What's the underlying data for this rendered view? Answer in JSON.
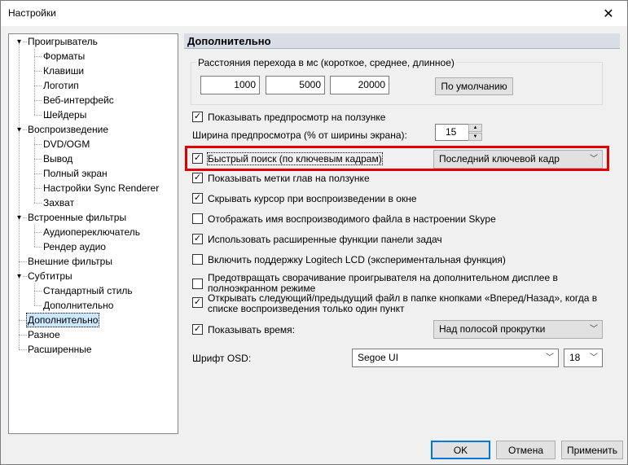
{
  "window": {
    "title": "Настройки",
    "close_glyph": "✕"
  },
  "tree": {
    "items": [
      {
        "label": "Проигрыватель",
        "level": 0,
        "expanded": true
      },
      {
        "label": "Форматы",
        "level": 1
      },
      {
        "label": "Клавиши",
        "level": 1
      },
      {
        "label": "Логотип",
        "level": 1
      },
      {
        "label": "Веб-интерфейс",
        "level": 1
      },
      {
        "label": "Шейдеры",
        "level": 1
      },
      {
        "label": "Воспроизведение",
        "level": 0,
        "expanded": true
      },
      {
        "label": "DVD/OGM",
        "level": 1
      },
      {
        "label": "Вывод",
        "level": 1
      },
      {
        "label": "Полный экран",
        "level": 1
      },
      {
        "label": "Настройки Sync Renderer",
        "level": 1
      },
      {
        "label": "Захват",
        "level": 1
      },
      {
        "label": "Встроенные фильтры",
        "level": 0,
        "expanded": true
      },
      {
        "label": "Аудиопереключатель",
        "level": 1
      },
      {
        "label": "Рендер аудио",
        "level": 1
      },
      {
        "label": "Внешние фильтры",
        "level": 0
      },
      {
        "label": "Субтитры",
        "level": 0,
        "expanded": true
      },
      {
        "label": "Стандартный стиль",
        "level": 1
      },
      {
        "label": "Дополнительно",
        "level": 1
      },
      {
        "label": "Дополнительно",
        "level": 0,
        "selected": true
      },
      {
        "label": "Разное",
        "level": 0
      },
      {
        "label": "Расширенные",
        "level": 0
      }
    ]
  },
  "page": {
    "header": "Дополнительно",
    "seek_group": {
      "legend": "Расстояния перехода в мс (короткое, среднее, длинное)",
      "short": "1000",
      "medium": "5000",
      "long": "20000",
      "default_button": "По умолчанию"
    },
    "preview_on_seekbar": {
      "label": "Показывать предпросмотр на ползунке",
      "checked": true
    },
    "preview_width": {
      "label": "Ширина предпросмотра (% от ширины экрана):",
      "value": "15"
    },
    "fast_seek": {
      "label": "Быстрый поиск (по ключевым кадрам)",
      "checked": true,
      "select_value": "Последний ключевой кадр"
    },
    "chapter_marks": {
      "label": "Показывать метки глав на ползунке",
      "checked": true
    },
    "hide_cursor": {
      "label": "Скрывать курсор при воспроизведении в окне",
      "checked": true
    },
    "skype_status": {
      "label": "Отображать имя воспроизводимого файла в настроении Skype",
      "checked": false
    },
    "taskbar": {
      "label": "Использовать расширенные функции панели задач",
      "checked": true
    },
    "logitech_lcd": {
      "label": "Включить поддержку Logitech LCD (экспериментальная функция)",
      "checked": false
    },
    "prevent_minimize": {
      "label": "Предотвращать сворачивание проигрывателя на дополнительном дисплее в полноэкранном режиме",
      "checked": false
    },
    "next_prev_single": {
      "label": "Открывать следующий/предыдущий файл в папке кнопками «Вперед/Назад», когда в списке воспроизведения только один пункт",
      "checked": true
    },
    "show_time": {
      "label": "Показывать время:",
      "checked": true,
      "select_value": "Над полосой прокрутки"
    },
    "osd_font": {
      "label": "Шрифт OSD:",
      "font_value": "Segoe UI",
      "size_value": "18"
    }
  },
  "footer": {
    "ok": "OK",
    "cancel": "Отмена",
    "apply": "Применить"
  },
  "colors": {
    "highlight_border": "#e00000",
    "selection": "#cce8ff",
    "header_bg": "#d8dde6",
    "default_button_border": "#0078d7"
  }
}
